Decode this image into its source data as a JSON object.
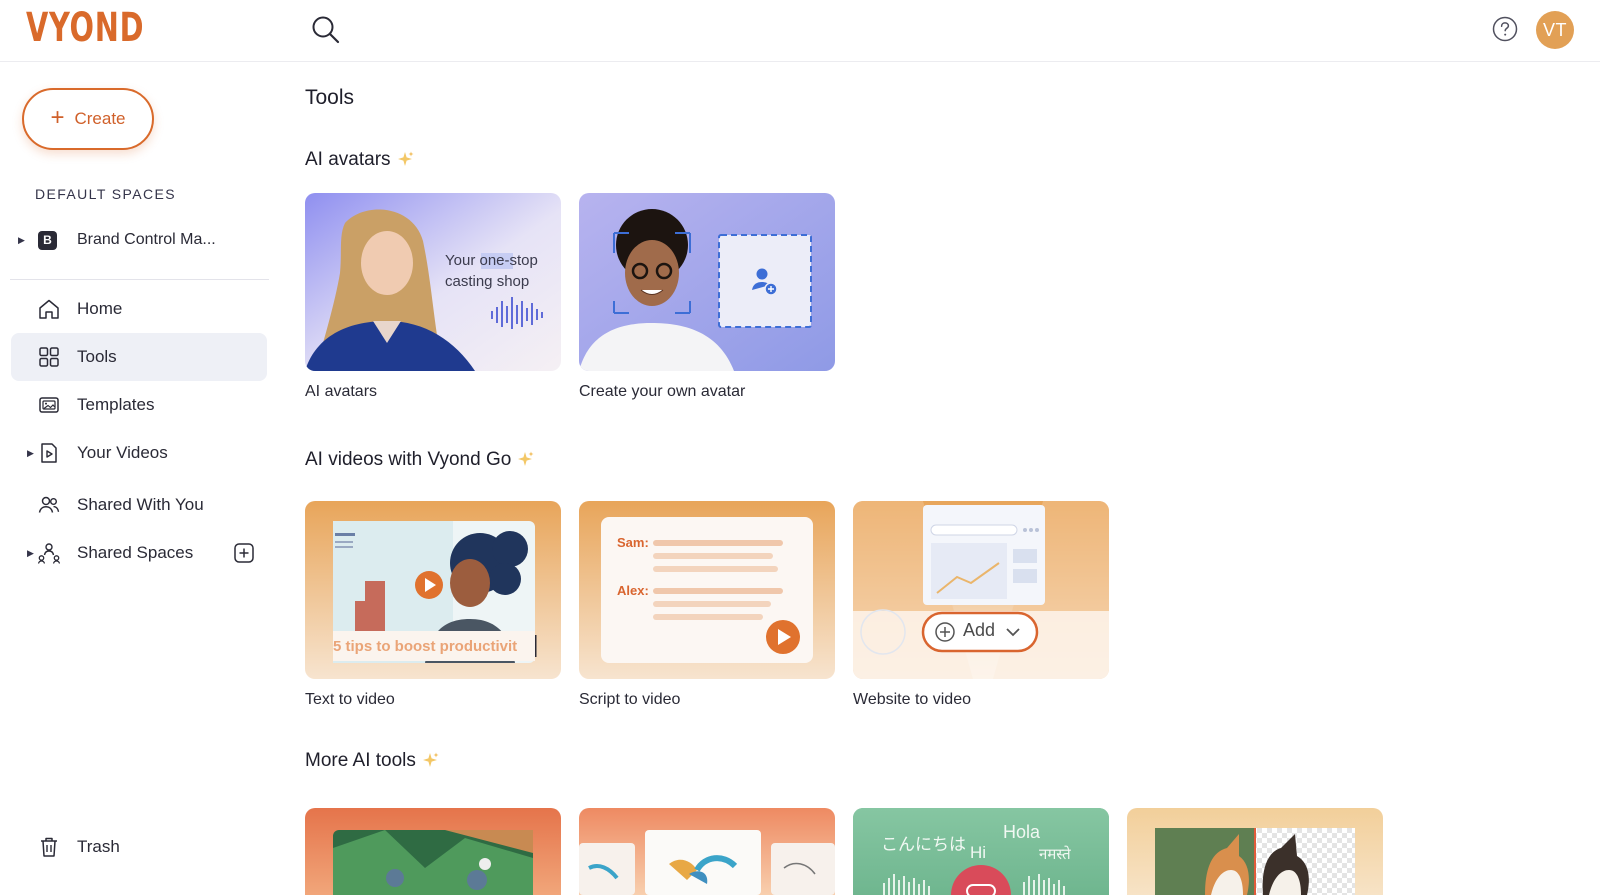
{
  "header": {
    "logo": "VYOND",
    "avatar_initials": "VT"
  },
  "sidebar": {
    "create_label": "Create",
    "section_label": "DEFAULT SPACES",
    "space": {
      "badge": "B",
      "name": "Brand Control Ma..."
    },
    "nav": [
      {
        "label": "Home",
        "icon": "home-icon"
      },
      {
        "label": "Tools",
        "icon": "grid-icon",
        "active": true
      },
      {
        "label": "Templates",
        "icon": "templates-icon"
      },
      {
        "label": "Your Videos",
        "icon": "video-file-icon",
        "expandable": true
      },
      {
        "label": "Shared With You",
        "icon": "people-icon"
      },
      {
        "label": "Shared Spaces",
        "icon": "shared-spaces-icon",
        "expandable": true
      }
    ],
    "trash_label": "Trash"
  },
  "main": {
    "title": "Tools",
    "sections": [
      {
        "title": "AI avatars",
        "cards": [
          {
            "label": "AI avatars",
            "thumb_text": [
              "Your one-stop",
              "casting shop"
            ]
          },
          {
            "label": "Create your own avatar"
          }
        ]
      },
      {
        "title": "AI videos with Vyond Go",
        "cards": [
          {
            "label": "Text to video",
            "thumb_text": "5 tips to boost productivit"
          },
          {
            "label": "Script to video",
            "thumb_speakers": [
              "Sam:",
              "Alex:"
            ]
          },
          {
            "label": "Website to video",
            "thumb_button": "Add"
          }
        ]
      },
      {
        "title": "More AI tools",
        "cards": [
          {
            "label": ""
          },
          {
            "label": ""
          },
          {
            "label": "",
            "thumb_words": [
              "こんにちは",
              "Hi",
              "Hola",
              "नमस्ते"
            ]
          },
          {
            "label": ""
          }
        ]
      }
    ]
  },
  "colors": {
    "brand": "#d96a2b",
    "active_nav_bg": "#eef0f6",
    "avatar_bg": "#e2a055"
  }
}
